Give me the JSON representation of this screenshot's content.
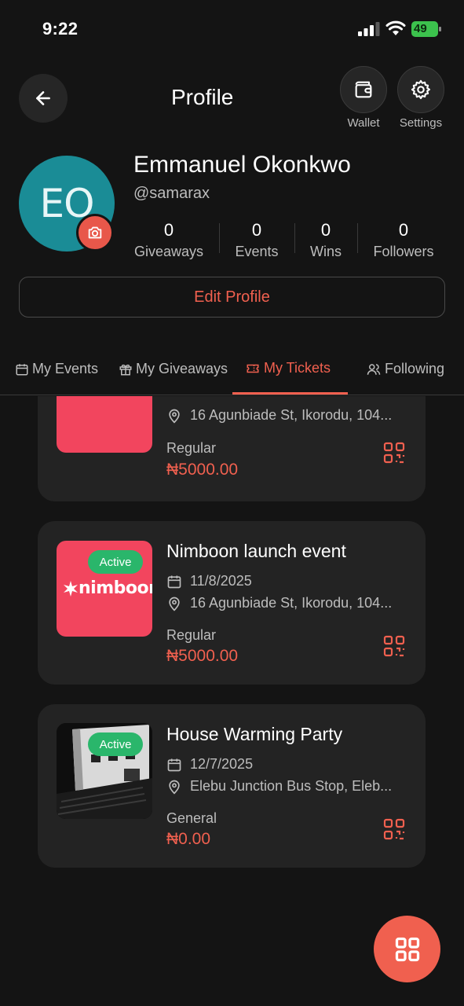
{
  "status_bar": {
    "time": "9:22",
    "battery": "49"
  },
  "header": {
    "title": "Profile",
    "wallet_label": "Wallet",
    "settings_label": "Settings"
  },
  "profile": {
    "initials": "EO",
    "name": "Emmanuel Okonkwo",
    "handle": "@samarax",
    "stats": [
      {
        "value": "0",
        "label": "Giveaways"
      },
      {
        "value": "0",
        "label": "Events"
      },
      {
        "value": "0",
        "label": "Wins"
      },
      {
        "value": "0",
        "label": "Followers"
      }
    ],
    "edit_label": "Edit Profile"
  },
  "tabs": [
    {
      "label": "My Events",
      "icon": "calendar-icon"
    },
    {
      "label": "My Giveaways",
      "icon": "gift-icon"
    },
    {
      "label": "My Tickets",
      "icon": "ticket-icon",
      "active": true
    },
    {
      "label": "Following",
      "icon": "users-icon"
    }
  ],
  "tickets": [
    {
      "title": "",
      "date": "",
      "location": "16 Agunbiade St, Ikorodu, 104...",
      "tier": "Regular",
      "price": "₦5000.00"
    },
    {
      "badge": "Active",
      "brand": "nimboon",
      "title": "Nimboon launch event",
      "date": "11/8/2025",
      "location": "16 Agunbiade St, Ikorodu, 104...",
      "tier": "Regular",
      "price": "₦5000.00"
    },
    {
      "badge": "Active",
      "title": "House Warming Party",
      "date": "12/7/2025",
      "location": "Elebu Junction Bus Stop, Eleb...",
      "tier": "General",
      "price": "₦0.00"
    }
  ],
  "colors": {
    "accent": "#f0604f",
    "active_badge": "#2ab66b",
    "avatar": "#1a8c96",
    "card": "#232323"
  }
}
